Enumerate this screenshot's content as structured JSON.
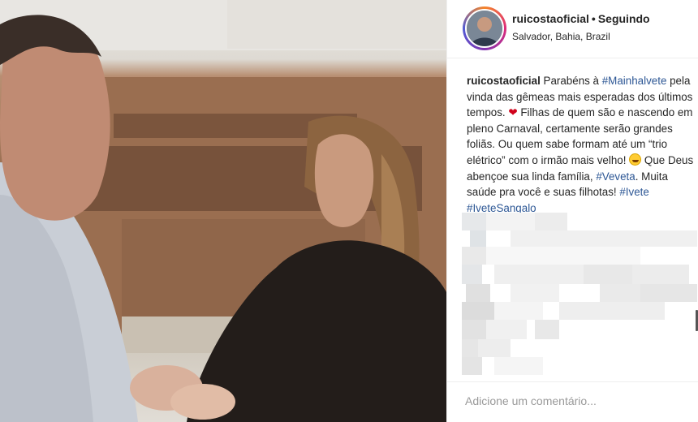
{
  "post": {
    "username": "ruicostaoficial",
    "separator": "•",
    "follow_status": "Seguindo",
    "location": "Salvador, Bahia, Brazil"
  },
  "caption": {
    "username": "ruicostaoficial",
    "t1": " Parabéns à ",
    "hashtag_mainhalvete": "#Mainhalvete",
    "t2": " pela vinda das gêmeas mais esperadas dos últimos tempos. ",
    "heart": "❤",
    "t3": " Filhas de quem são e nascendo em pleno Carnaval, certamente serão grandes foliãs. Ou quem sabe formam até um “trio elétrico” com o irmão mais velho! ",
    "t4": " Que Deus abençoe sua linda família, ",
    "hashtag_veveta": "#Veveta",
    "t5": ". Muita saúde pra você e suas filhotas! ",
    "hashtag_ivete": "#Ivete",
    "hashtag_ivetesangalo": "#IveteSangalo"
  },
  "comment_box": {
    "placeholder": "Adicione um comentário..."
  },
  "icons": {
    "heart": "heart-emoji-icon",
    "face": "grinning-sweat-emoji-icon"
  },
  "colors": {
    "link": "#2d5795",
    "text": "#262626",
    "muted": "#999999",
    "heart": "#d0021b"
  }
}
